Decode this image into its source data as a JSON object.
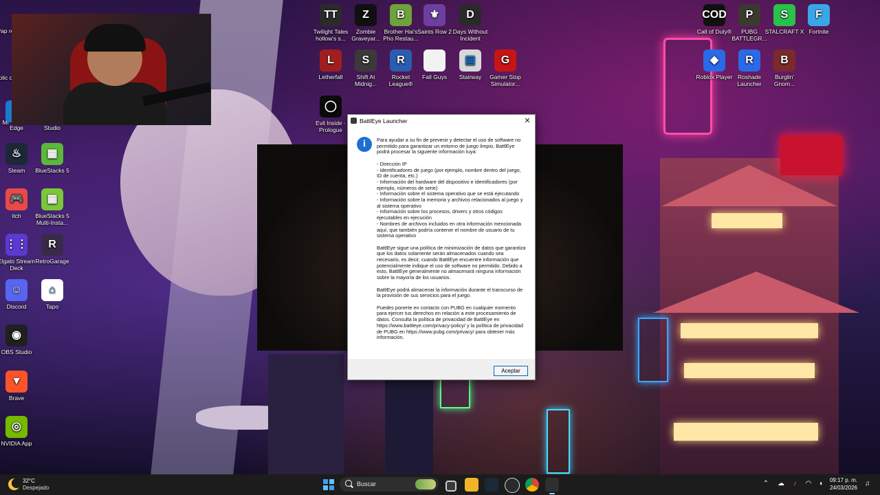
{
  "desktop_icons": [
    {
      "label": "Twilight Tales hollow's s...",
      "icon": "twilight-tales-icon",
      "color": "#2b2b2b",
      "glyph": "TT"
    },
    {
      "label": "Zombie Graveyar...",
      "icon": "zombie-graveyard-icon",
      "color": "#101010",
      "glyph": "Z"
    },
    {
      "label": "Brother Hai's Pho Restau...",
      "icon": "brother-hais-icon",
      "color": "#6da33a",
      "glyph": "B"
    },
    {
      "label": "Saints Row 2",
      "icon": "saints-row-icon",
      "color": "#6c3fa0",
      "glyph": "⚜"
    },
    {
      "label": "Days Without Incident",
      "icon": "days-without-incident-icon",
      "color": "#2a2a2a",
      "glyph": "D"
    },
    {
      "label": "Letherfall",
      "icon": "letherfall-icon",
      "color": "#a01e1e",
      "glyph": "L"
    },
    {
      "label": "Shift At Midnig...",
      "icon": "shift-at-midnight-icon",
      "color": "#3a3a3a",
      "glyph": "S"
    },
    {
      "label": "Rocket League®",
      "icon": "rocket-league-icon",
      "color": "#2a5db0",
      "glyph": "R"
    },
    {
      "label": "Fall Guys",
      "icon": "fall-guys-icon",
      "color": "#f2f2f2",
      "glyph": ""
    },
    {
      "label": "Stairway",
      "icon": "stairway-icon",
      "color": "#d8d8d8",
      "glyph": "▤"
    },
    {
      "label": "Gamer Stop Simulator...",
      "icon": "gamer-stop-icon",
      "color": "#c81414",
      "glyph": "G"
    },
    {
      "label": "Evil Inside - Prologue",
      "icon": "evil-inside-icon",
      "color": "#0a0a0a",
      "glyph": "◯"
    },
    {
      "label": "Call of Duty®",
      "icon": "call-of-duty-icon",
      "color": "#111111",
      "glyph": "COD"
    },
    {
      "label": "PUBG BATTLEGR...",
      "icon": "pubg-icon",
      "color": "#3a3a30",
      "glyph": "P"
    },
    {
      "label": "STALCRAFT X",
      "icon": "stalcraft-icon",
      "color": "#28c24a",
      "glyph": "S"
    },
    {
      "label": "Fortnite",
      "icon": "fortnite-icon",
      "color": "#3aa6e8",
      "glyph": "F"
    },
    {
      "label": "Roblox Player",
      "icon": "roblox-icon",
      "color": "#2a6ae8",
      "glyph": "◆"
    },
    {
      "label": "Roshade Launcher",
      "icon": "roshade-icon",
      "color": "#2a6ae8",
      "glyph": "R"
    },
    {
      "label": "Burglin' Gnom...",
      "icon": "burglin-gnomes-icon",
      "color": "#7a2a2a",
      "glyph": "B"
    },
    {
      "label": "Studio",
      "icon": "studio-icon",
      "color": "#3a3a3a",
      "glyph": ""
    },
    {
      "label": "Edge",
      "icon": "edge-icon",
      "color": "#1a7ad0",
      "glyph": ""
    },
    {
      "label": "Steam",
      "icon": "steam-icon",
      "color": "#1b2838",
      "glyph": "♨"
    },
    {
      "label": "BlueStacks 5",
      "icon": "bluestacks-icon",
      "color": "#5ab83a",
      "glyph": "▦"
    },
    {
      "label": "itch",
      "icon": "itch-icon",
      "color": "#e84a4a",
      "glyph": "🎮"
    },
    {
      "label": "BlueStacks 5 Multi-Insta...",
      "icon": "bluestacks-multi-icon",
      "color": "#7ac83a",
      "glyph": "▦"
    },
    {
      "label": "Elgato Stream Deck",
      "icon": "stream-deck-icon",
      "color": "#5a3ad0",
      "glyph": "⋮⋮"
    },
    {
      "label": "RetroGarage",
      "icon": "retrogarage-icon",
      "color": "#3a2a4a",
      "glyph": "R"
    },
    {
      "label": "Discord",
      "icon": "discord-icon",
      "color": "#5865f2",
      "glyph": "☺"
    },
    {
      "label": "Tapo",
      "icon": "tapo-icon",
      "color": "#ffffff",
      "glyph": "⌂"
    },
    {
      "label": "OBS Studio",
      "icon": "obs-icon",
      "color": "#202020",
      "glyph": "◉"
    },
    {
      "label": "Brave",
      "icon": "brave-icon",
      "color": "#fb542b",
      "glyph": "▼"
    },
    {
      "label": "NVIDIA App",
      "icon": "nvidia-icon",
      "color": "#76b900",
      "glyph": "◎"
    }
  ],
  "partial_labels": {
    "left1": "Pap re",
    "left2": "Aplic qu",
    "left3": "Mi"
  },
  "splash": {
    "text": "BA        S"
  },
  "dialog": {
    "title": "BattlEye Launcher",
    "body": "Para ayudar a su fin de prevenir y detectar el uso de software no permitido para garantizar un entorno de juego limpio, BattlEye podrá procesar la siguiente información tuya:\n\n- Dirección IP\n- Identificadores de juego (por ejemplo, nombre dentro del juego, ID de cuenta, etc.)\n- Información del hardware del dispositivo e identificadores (por ejemplo, números de serie)\n- Información sobre el sistema operativo que se está ejecutando\n- Información sobre la memoria y archivos relacionados al juego y al sistema operativo\n- Información sobre los procesos, drivers y otros códigos ejecutables en ejecución\n- Nombres de archivos incluidos en otra información mencionada aquí, que también podría contener el nombre de usuario de tu sistema operativo\n\nBattlEye sigue una política de minimización de datos que garantiza que los datos solamente serán almacenados cuando sea necesario, es decir, cuando BattlEye encuentre información que potencialmente indique el uso de software no permitido. Debido a esto, BattlEye generalmente no almacenará ninguna información sobre la mayoría de los usuarios.\n\nBattlEye podrá almacenar la información durante el transcurso de la provisión de sus servicios para el juego.\n\nPuedes ponerte en contacto con PUBG en cualquier momento para ejercer tus derechos en relación a este procesamiento de datos. Consulta la política de privacidad de BattlEye en https://www.battleye.com/privacy-policy/ y la política de privacidad de PUBG en https://www.pubg.com/privacy/ para obtener más información.",
    "accept_label": "Aceptar",
    "close_glyph": "✕",
    "info_glyph": "i"
  },
  "taskbar": {
    "weather_temp": "32°C",
    "weather_desc": "Despejado",
    "search_label": "Buscar",
    "time": "09:17 p. m.",
    "date": "24/03/2026"
  }
}
